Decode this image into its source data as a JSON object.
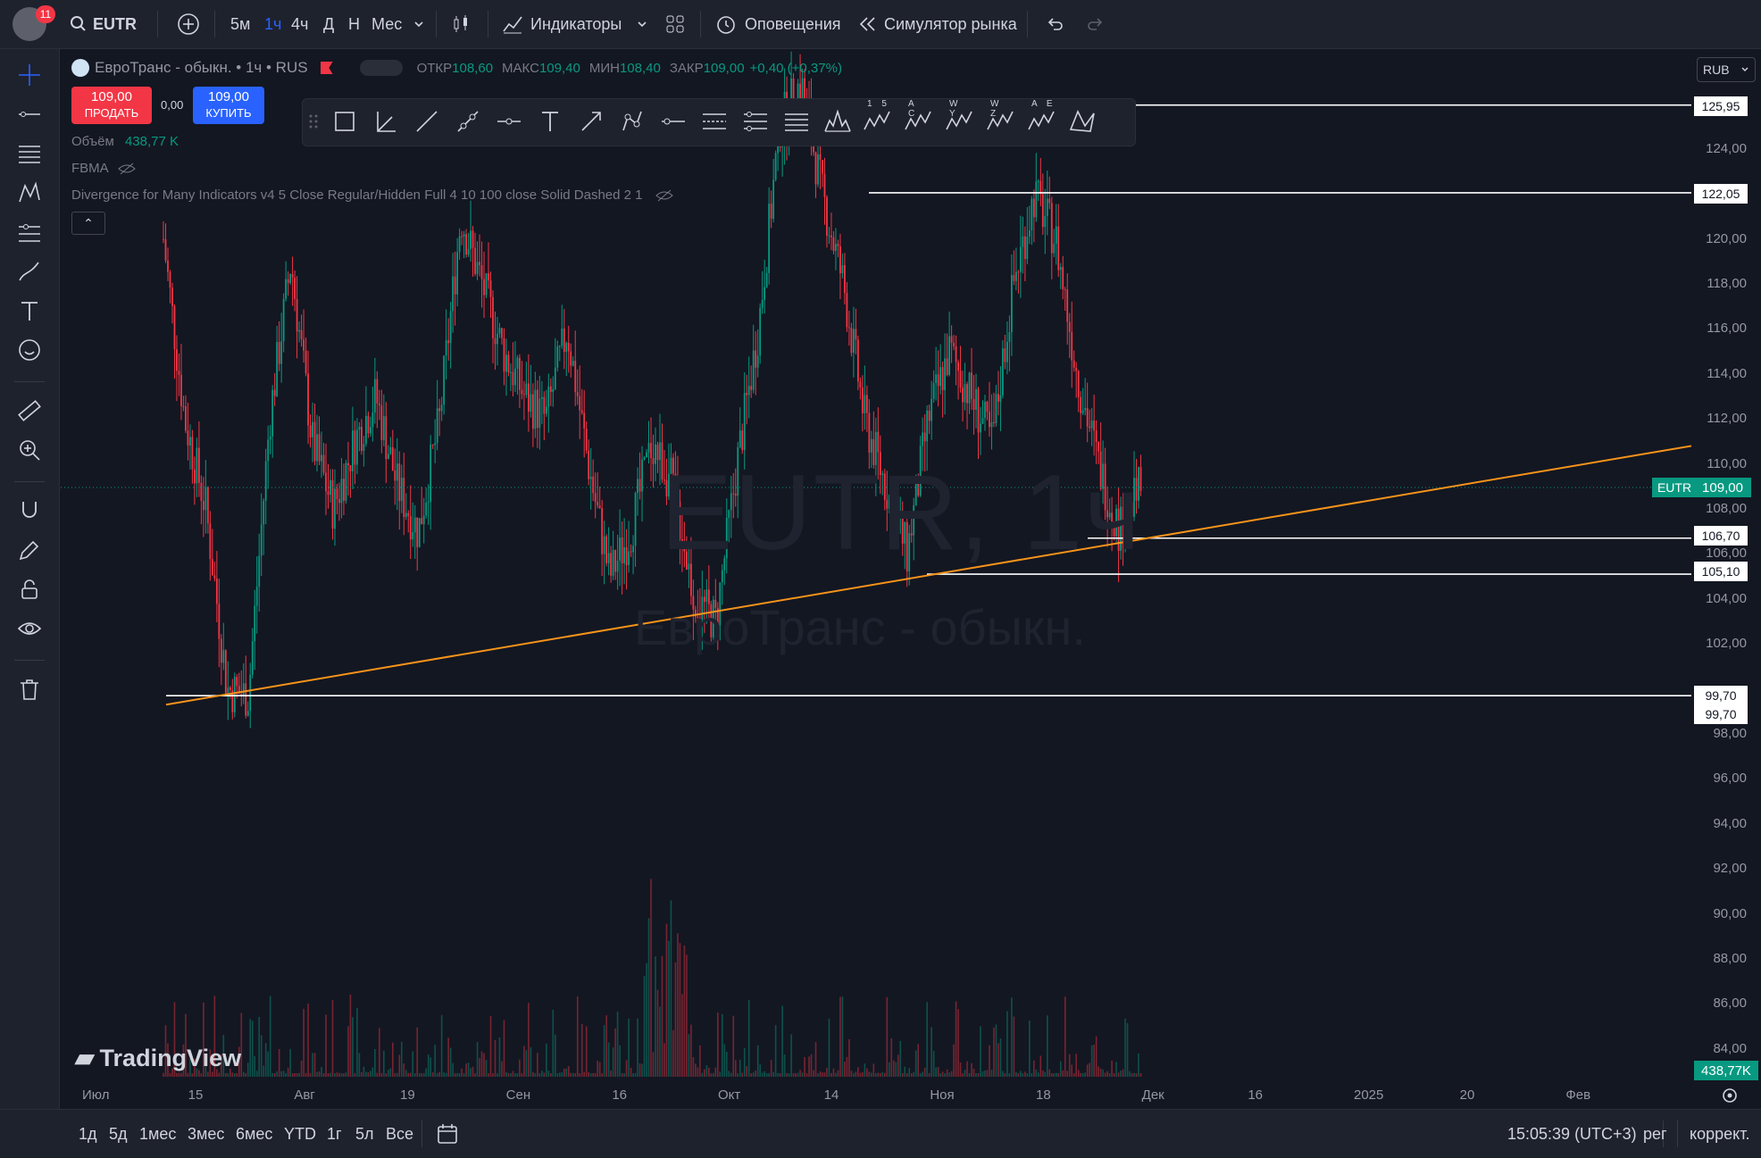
{
  "topbar": {
    "badge": "11",
    "symbol": "EUTR",
    "timeframes": [
      "5м",
      "1ч",
      "4ч",
      "Д",
      "Н",
      "Мес"
    ],
    "active_timeframe": "1ч",
    "indicators_label": "Индикаторы",
    "alerts_label": "Оповещения",
    "replay_label": "Симулятор рынка"
  },
  "legend": {
    "title": "ЕвроТранс - обыкн. • 1ч • RUS",
    "open_label": "ОТКР",
    "open_value": "108,60",
    "high_label": "МАКС",
    "high_value": "109,40",
    "low_label": "МИН",
    "low_value": "108,40",
    "close_label": "ЗАКР",
    "close_value": "109,00",
    "change": "+0,40 (+0,37%)",
    "volume_label": "Объём",
    "volume_value": "438,77 K",
    "fbma_label": "FBMA",
    "divergence_label": "Divergence for Many Indicators v4 5 Close Regular/Hidden Full 4 10 100 close Solid Dashed 2 1"
  },
  "trade": {
    "sell_price": "109,00",
    "sell_label": "ПРОДАТЬ",
    "spread": "0,00",
    "buy_price": "109,00",
    "buy_label": "КУПИТЬ"
  },
  "currency": "RUB",
  "price_axis": {
    "ticks": [
      "124,00",
      "120,00",
      "118,00",
      "116,00",
      "114,00",
      "112,00",
      "110,00",
      "108,00",
      "106,00",
      "104,00",
      "102,00",
      "98,00",
      "96,00",
      "94,00",
      "92,00",
      "90,00",
      "88,00",
      "86,00",
      "84,00"
    ],
    "level_boxes": [
      "125,95",
      "122,05",
      "106,70",
      "105,10",
      "99,70",
      "99,70"
    ],
    "symbol_tag": "EUTR",
    "last_price": "109,00",
    "volume_tag": "438,77K"
  },
  "time_axis": [
    "Июл",
    "15",
    "Авг",
    "19",
    "Сен",
    "16",
    "Окт",
    "14",
    "Ноя",
    "18",
    "Дек",
    "16",
    "2025",
    "20",
    "Фев"
  ],
  "watermark": {
    "symbol": "EUTR, 1ч",
    "name": "ЕвроТранс - обыкн."
  },
  "brand": "TradingView",
  "bottombar": {
    "ranges": [
      "1д",
      "5д",
      "1мес",
      "3мес",
      "6мес",
      "YTD",
      "1г",
      "5л",
      "Все"
    ],
    "time": "15:05:39 (UTC+3)",
    "session": "рег",
    "adjust": "коррект."
  },
  "drawing_labels": [
    "1 5",
    "A C",
    "W Y",
    "W Z",
    "A E"
  ],
  "chart_data": {
    "type": "candlestick",
    "title": "ЕвроТранс - обыкн. • 1ч • RUS",
    "y_range": [
      83.0,
      128.0
    ],
    "horizontal_levels": [
      125.95,
      122.05,
      106.7,
      105.1,
      99.7
    ],
    "trendline": {
      "from_price": 99.3,
      "to_price": 110.8
    },
    "last_price": 109.0,
    "last_volume": "438,77K",
    "price_path": [
      120,
      112,
      108,
      100,
      99.7,
      112,
      119,
      111,
      108,
      111,
      113,
      109,
      107,
      112,
      121,
      118,
      115,
      113,
      112,
      116,
      110,
      105,
      107,
      111,
      109,
      104,
      103,
      110,
      116,
      125,
      127,
      122,
      118,
      112,
      109,
      106,
      112,
      115,
      113,
      111,
      118,
      122,
      120,
      114,
      110,
      107,
      109
    ]
  }
}
